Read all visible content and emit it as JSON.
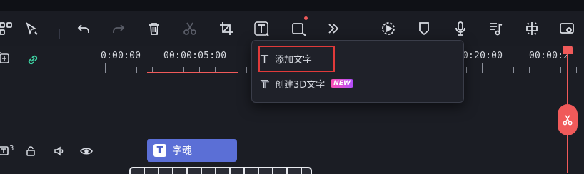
{
  "ruler": {
    "timecodes": [
      "0:00:00",
      "00:00:05:00",
      "0:20:00",
      "00:00:2"
    ]
  },
  "dropdown": {
    "items": [
      {
        "label": "添加文字",
        "icon": "text-icon"
      },
      {
        "label": "创建3D文字",
        "icon": "3d-text-icon",
        "badge": "NEW"
      }
    ]
  },
  "left_panel": {
    "track_number": "3"
  },
  "clip": {
    "badge": "T",
    "label": "字魂"
  },
  "colors": {
    "playhead": "#f05a5a",
    "clip": "#5b6fd6",
    "highlight": "#e03a3a"
  }
}
